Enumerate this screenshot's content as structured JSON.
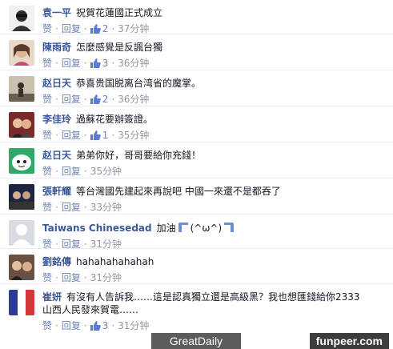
{
  "actions": {
    "like": "赞",
    "reply": "回复",
    "dot": "·"
  },
  "comments": [
    {
      "author": "袁一平",
      "text": "祝賀花蓮國正式成立",
      "likes": "2",
      "time": "37分钟",
      "avatar_color": "#2a2a2a"
    },
    {
      "author": "陳雨奇",
      "text": "怎麼感覺是反諷台獨",
      "likes": "3",
      "time": "36分钟",
      "avatar_color": "#c9a07a"
    },
    {
      "author": "赵日天",
      "text": "恭喜贵国脱离台湾省的魔掌。",
      "likes": "2",
      "time": "36分钟",
      "avatar_color": "#8a7a60"
    },
    {
      "author": "李佳玲",
      "text": "過蘇花要辦簽證。",
      "likes": "1",
      "time": "35分钟",
      "avatar_color": "#a3443f"
    },
    {
      "author": "赵日天",
      "text": "弟弟你好，哥哥要給你充錢！",
      "likes": "",
      "time": "35分钟",
      "avatar_color": "#3cbf7c"
    },
    {
      "author": "張軒耀",
      "text": "等台灣國先建起來再說吧 中國一來還不是都吞了",
      "likes": "",
      "time": "33分钟",
      "avatar_color": "#3a3f5a"
    },
    {
      "author": "Taiwans Chinesedad",
      "text": "加油",
      "text_after": "(^ω^)",
      "likes": "",
      "time": "31分钟",
      "avatar_color": "#d8dbe2"
    },
    {
      "author": "劉銘傳",
      "text": "hahahahahahah",
      "likes": "",
      "time": "31分钟",
      "avatar_color": "#5a4a40"
    },
    {
      "author": "崔妍",
      "text": "有沒有人告訴我……這是認真獨立還是高級黑？我也想匯錢給你2333",
      "text2": "山西人民發來賀電……",
      "likes": "3",
      "time": "31分钟",
      "avatar_color": "#d03a3a"
    }
  ],
  "watermark_left": "GreatDaily",
  "watermark_right": "funpeer.com",
  "colors": {
    "author": "#3b5998",
    "meta": "#9197a3",
    "link": "#6d84b4"
  }
}
